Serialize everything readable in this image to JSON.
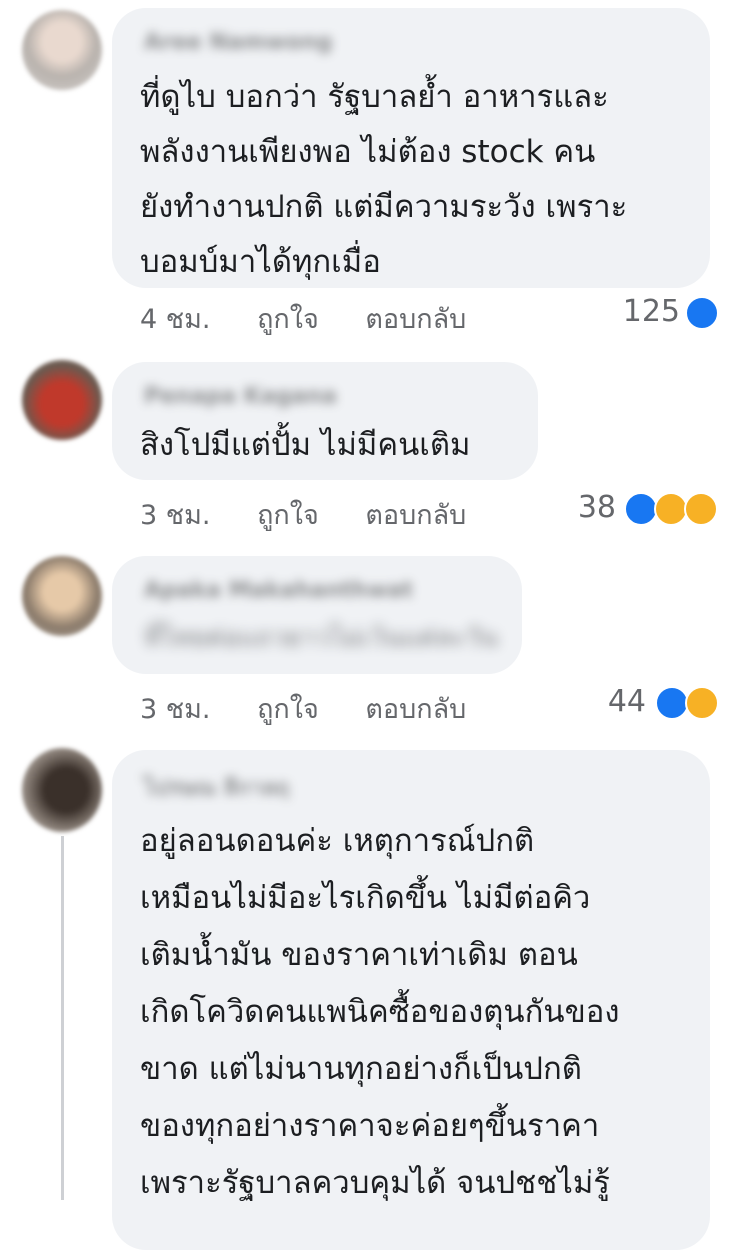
{
  "comments": [
    {
      "author": "Aree Namwong",
      "lines": [
        "ที่ดูไบ บอกว่า รัฐบาลย้ำ อาหารและ",
        "พลังงานเพียงพอ ไม่ต้อง stock คน",
        "ยังทำงานปกติ แต่มีความระวัง เพราะ",
        "บอมบ์มาได้ทุกเมื่อ"
      ],
      "time": "4 ชม.",
      "like_label": "ถูกใจ",
      "reply_label": "ตอบกลับ",
      "reaction_count": "125",
      "reactions": [
        "like-icon"
      ],
      "colors": {
        "avatar": "#c9c6c4"
      }
    },
    {
      "author": "Penapa Kagana",
      "lines": [
        "สิงโปมีแต่ปั้ม ไม่มีคนเติม"
      ],
      "time": "3 ชม.",
      "like_label": "ถูกใจ",
      "reply_label": "ตอบกลับ",
      "reaction_count": "38",
      "reactions": [
        "like-icon",
        "haha-icon",
        "wow-icon"
      ],
      "colors": {
        "avatar": "#b84a3c"
      }
    },
    {
      "author": "Apaka Makahanthwat",
      "lines": [
        "ที่ไทยต่อแถวยาวไม่เว้นแต่ละวัน"
      ],
      "time": "3 ชม.",
      "like_label": "ถูกใจ",
      "reply_label": "ตอบกลับ",
      "reaction_count": "44",
      "reactions": [
        "like-icon",
        "haha-icon"
      ],
      "colors": {
        "avatar": "#8c7c6c"
      }
    },
    {
      "author": "ไปรษณ ลีกาลฤ",
      "lines": [
        "อยู่ลอนดอนค่ะ   เหตุการณ์ปกติ",
        "เหมือนไม่มีอะไรเกิดขึ้น    ไม่มีต่อคิว",
        "เติมน้ำมัน   ของราคาเท่าเดิม   ตอน",
        "เกิดโควิดคนแพนิคซื้อของตุนกันของ",
        "ขาด   แต่ไม่นานทุกอย่างก็เป็นปกติ",
        "ของทุกอย่างราคาจะค่อยๆขึ้นราคา",
        "เพราะรัฐบาลควบคุมได้   จนปชชไม่รู้"
      ],
      "colors": {
        "avatar": "#5a5048"
      }
    }
  ],
  "colors": {
    "bubble": "#f0f2f5",
    "like": "#1877f2",
    "emoji": "#f7b125",
    "meta": "#65676b"
  }
}
